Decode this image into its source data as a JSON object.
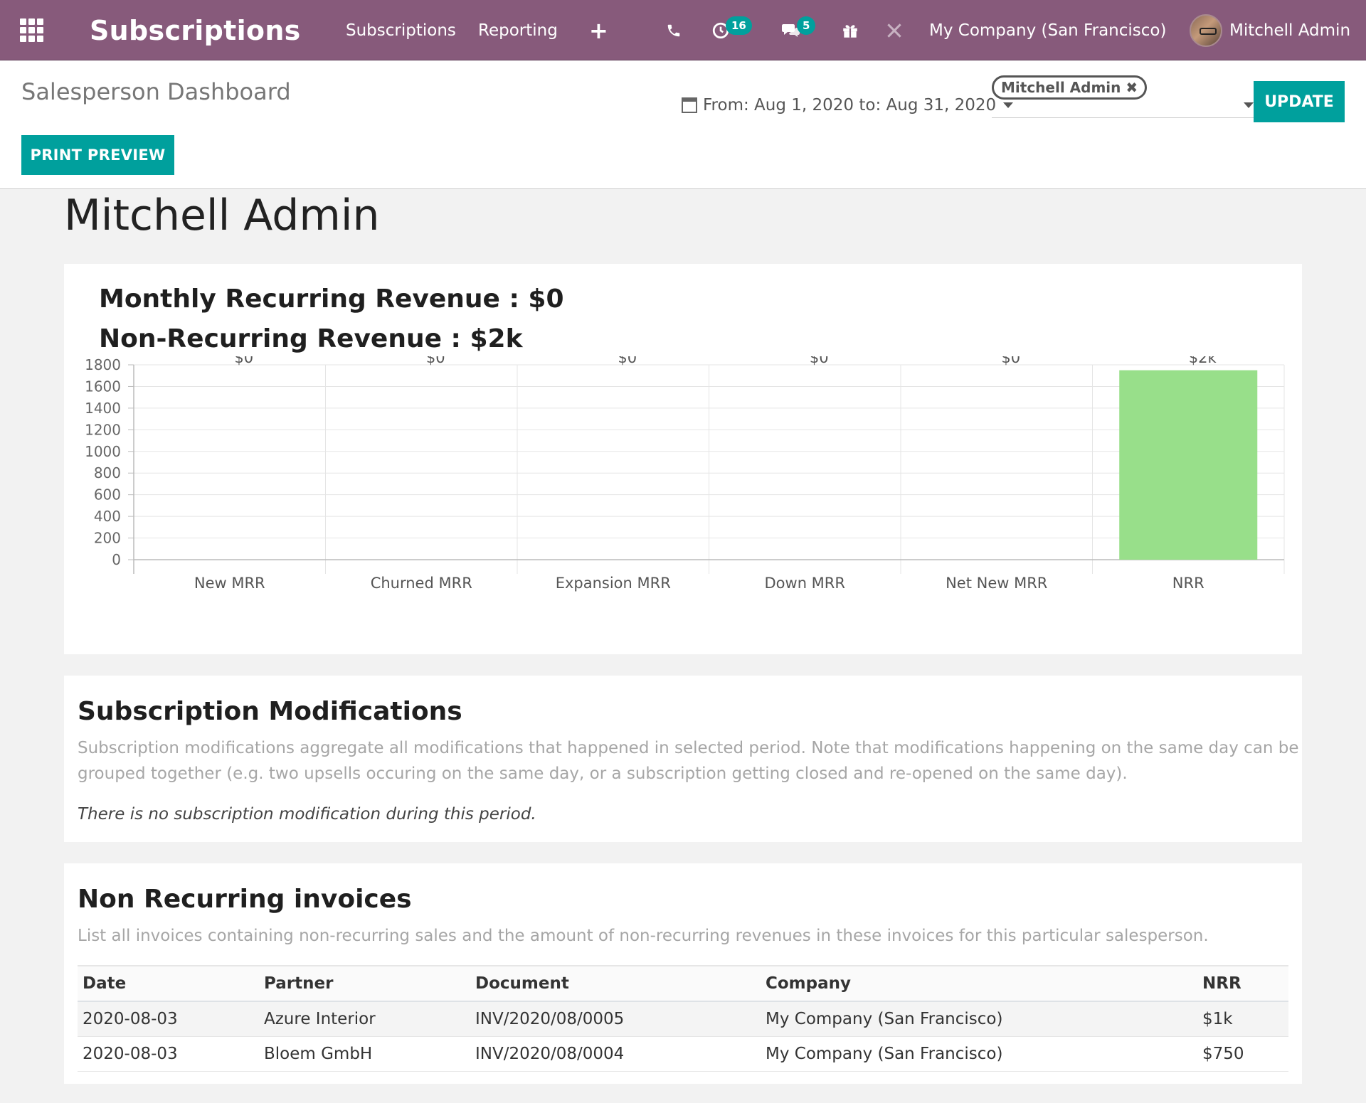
{
  "navbar": {
    "app_title": "Subscriptions",
    "menu": [
      "Subscriptions",
      "Reporting"
    ],
    "plus_label": "+",
    "activity_count": "16",
    "message_count": "5",
    "company": "My Company (San Francisco)",
    "user": "Mitchell Admin",
    "icons": [
      "apps-grid-icon",
      "phone-icon",
      "clock-icon",
      "chat-icon",
      "gift-icon",
      "tools-icon"
    ]
  },
  "control_panel": {
    "title": "Salesperson Dashboard",
    "print_preview_label": "PRINT PREVIEW",
    "date_range": "From: Aug 1, 2020 to: Aug 31, 2020",
    "salesperson_tag": "Mitchell Admin",
    "update_label": "UPDATE"
  },
  "content": {
    "user_heading": "Mitchell Admin",
    "mrr_kpi": "Monthly Recurring Revenue : $0",
    "nrr_kpi": "Non-Recurring Revenue : $2k"
  },
  "chart_data": {
    "type": "bar",
    "categories": [
      "New MRR",
      "Churned MRR",
      "Expansion MRR",
      "Down MRR",
      "Net New MRR",
      "NRR"
    ],
    "values": [
      0,
      0,
      0,
      0,
      0,
      1750
    ],
    "data_labels": [
      "$0",
      "$0",
      "$0",
      "$0",
      "$0",
      "$2k"
    ],
    "yticks": [
      0,
      200,
      400,
      600,
      800,
      1000,
      1200,
      1400,
      1600,
      1800
    ],
    "ylim": [
      0,
      1800
    ],
    "bar_color": "#98df8a",
    "grid": true
  },
  "modifications": {
    "title": "Subscription Modifications",
    "description": "Subscription modifications aggregate all modifications that happened in selected period. Note that modifications happening on the same day can be grouped together (e.g. two upsells occuring on the same day, or a subscription getting closed and re-opened on the same day).",
    "empty_message": "There is no subscription modification during this period."
  },
  "non_recurring": {
    "title": "Non Recurring invoices",
    "description": "List all invoices containing non-recurring sales and the amount of non-recurring revenues in these invoices for this particular salesperson.",
    "columns": [
      "Date",
      "Partner",
      "Document",
      "Company",
      "NRR"
    ],
    "rows": [
      [
        "2020-08-03",
        "Azure Interior",
        "INV/2020/08/0005",
        "My Company (San Francisco)",
        "$1k"
      ],
      [
        "2020-08-03",
        "Bloem GmbH",
        "INV/2020/08/0004",
        "My Company (San Francisco)",
        "$750"
      ]
    ]
  },
  "colors": {
    "brand": "#875a7b",
    "accent": "#00a09d"
  }
}
